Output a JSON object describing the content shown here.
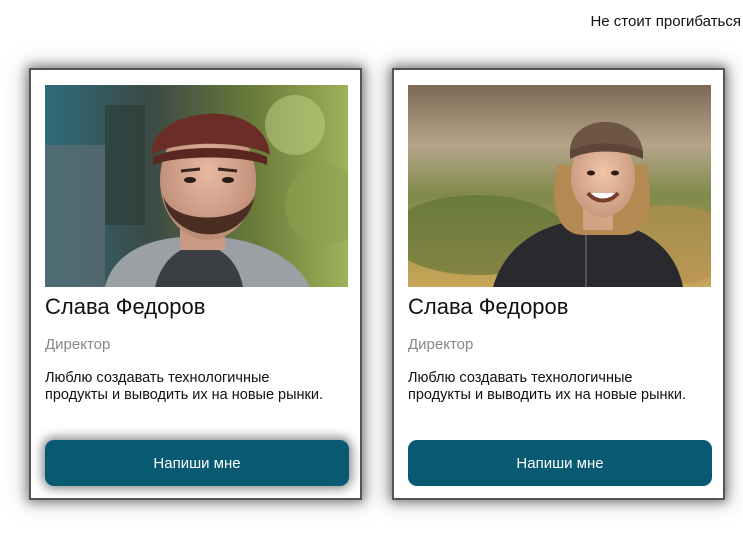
{
  "header": {
    "text": "Не стоит прогибаться"
  },
  "cards": [
    {
      "image": "man-portrait-photo",
      "name": "Слава Федоров",
      "role": "Директор",
      "description": "Люблю создавать технологичные продукты и выводить их на новые рынки.",
      "button_label": "Напиши мне"
    },
    {
      "image": "woman-portrait-photo",
      "name": "Слава Федоров",
      "role": "Директор",
      "description": "Люблю создавать технологичные продукты и выводить их на новые рынки.",
      "button_label": "Напиши мне"
    }
  ],
  "colors": {
    "button_bg": "#085a73",
    "button_text": "#ffffff",
    "role_text": "#888888",
    "card_border": "#555555"
  }
}
